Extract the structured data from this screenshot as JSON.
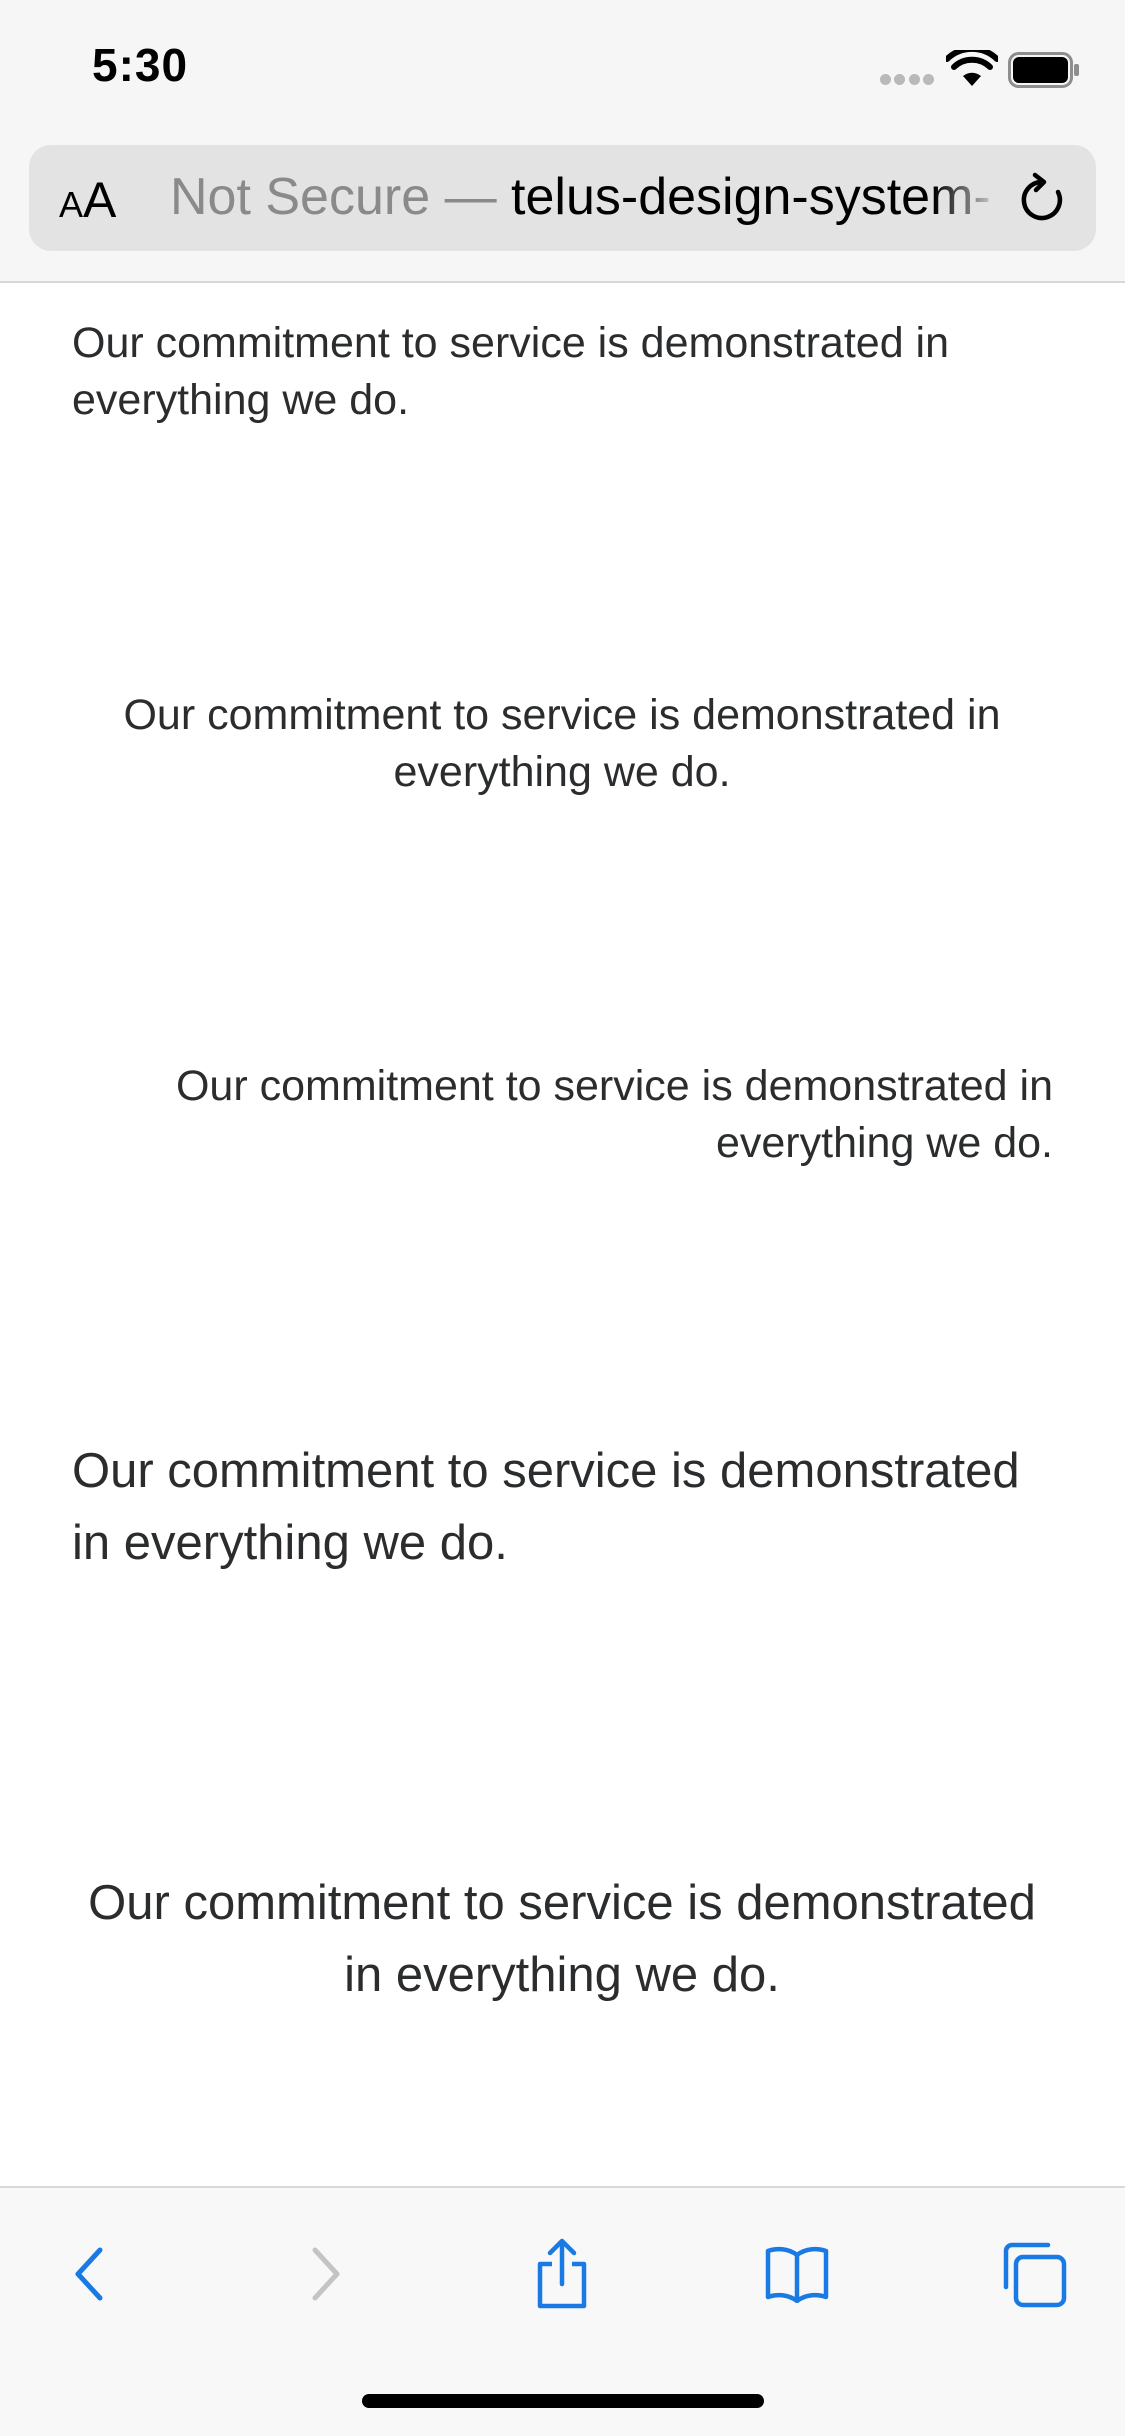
{
  "status_bar": {
    "time": "5:30"
  },
  "address_bar": {
    "aa_small": "A",
    "aa_large": "A",
    "security_label": "Not Secure — ",
    "host": "telus-design-system-"
  },
  "content": {
    "paragraphs": [
      {
        "text": "Our commitment to service is demonstrated in everything we do.",
        "align": "left"
      },
      {
        "text": "Our commitment to service is demonstrated in everything we do.",
        "align": "center"
      },
      {
        "text": "Our commitment to service is demonstrated in everything we do.",
        "align": "right"
      },
      {
        "text": "Our commitment to service is demonstrated in everything we do.",
        "align": "left"
      },
      {
        "text": "Our commitment to service is demonstrated in everything we do.",
        "align": "center"
      }
    ]
  },
  "toolbar": {
    "back_enabled": true,
    "forward_enabled": false
  },
  "colors": {
    "accent": "#1a7ae4",
    "disabled": "#c4c4c4",
    "text": "#2a2c2e",
    "chrome_bg": "#f6f6f6"
  }
}
